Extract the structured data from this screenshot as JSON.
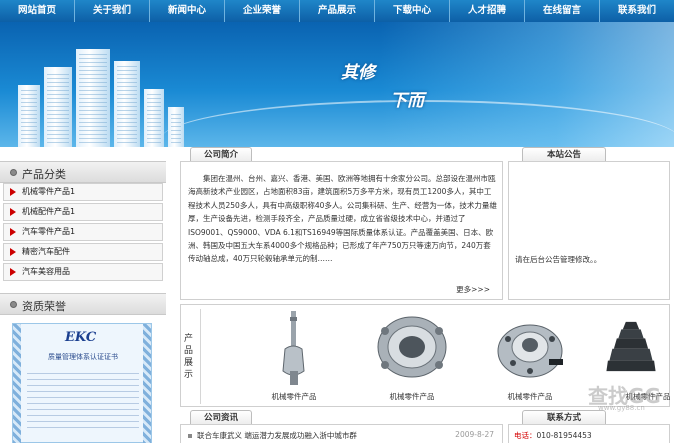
{
  "nav": {
    "items": [
      "网站首页",
      "关于我们",
      "新闻中心",
      "企业荣誉",
      "产品展示",
      "下载中心",
      "人才招聘",
      "在线留言",
      "联系我们"
    ]
  },
  "banner": {
    "slogan_line1": "其修",
    "slogan_line2": "下而"
  },
  "sidebar": {
    "category_title": "产品分类",
    "categories": [
      "机械零件产品1",
      "机械配件产品1",
      "汽车零件产品1",
      "精密汽车配件",
      "汽车美容用品"
    ],
    "honor_title": "资质荣誉",
    "cert_logo": "EKC",
    "cert_title": "质量管理体系认证证书"
  },
  "about": {
    "tab": "公司简介",
    "text": "集团在温州、台州、嘉兴、香港、美国、欧洲等地拥有十余家分公司。总部设在温州市瓯海高新技术产业园区，占地面积83亩，建筑面积5万多平方米，现有员工1200多人，其中工程技术人员250多人，具有中高级职称40多人。公司集科研、生产、经营为一体，技术力量雄厚，生产设备先进，检测手段齐全，产品质量过硬，成立省省级技术中心，并通过了ISO9001、QS9000、VDA 6.1和TS16949等国际质量体系认证。产品覆盖美国、日本、欧洲、韩国及中国五大车系4000多个规格品种；已形成了年产750万只等速万向节，240万套传动轴总成，40万只轮毂轴承单元的制……",
    "more": "更多>>>"
  },
  "notice": {
    "tab": "本站公告",
    "text": "请在后台公告管理修改。。"
  },
  "products": {
    "vertical_label": "产品展示",
    "items": [
      {
        "caption": "机械零件产品",
        "icon": "cv-joint-shaft-icon"
      },
      {
        "caption": "机械零件产品",
        "icon": "bearing-housing-icon"
      },
      {
        "caption": "机械零件产品",
        "icon": "wheel-hub-icon"
      },
      {
        "caption": "机械零件产品",
        "icon": "rubber-boot-icon"
      }
    ]
  },
  "news": {
    "tab": "公司资讯",
    "item": "联合车康武义 端运潜力发展成功融入浙中城市群",
    "date": "2009-8-27"
  },
  "contact": {
    "tab": "联系方式",
    "phone_label": "电话：",
    "phone": "010-81954453"
  },
  "watermark": {
    "text": "查找GG",
    "sub": "www.gy88.cn"
  }
}
